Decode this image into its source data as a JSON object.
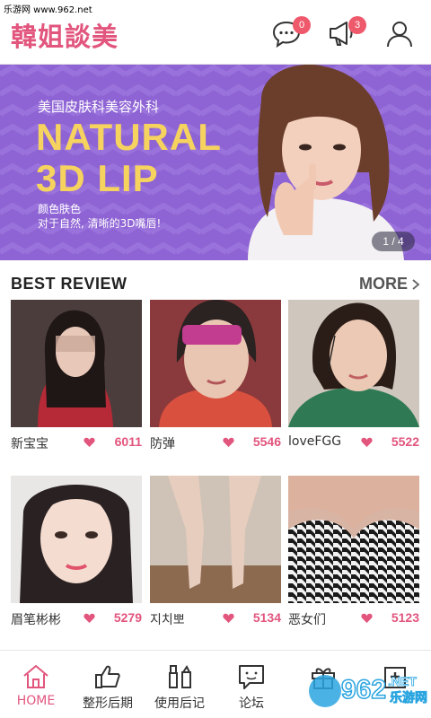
{
  "watermark_top": "乐游网 www.962.net",
  "header": {
    "logo": "韓姐談美",
    "chat_badge": "0",
    "notice_badge": "3",
    "icons": [
      "chat-icon",
      "megaphone-icon",
      "user-icon"
    ]
  },
  "banner": {
    "subtitle": "美国皮肤科美容外科",
    "title_line1": "NATURAL",
    "title_line2": "3D LIP",
    "desc_line1": "颜色肤色",
    "desc_line2": "对于自然, 清晰的3D嘴唇!",
    "pager": "1 / 4",
    "colors": {
      "bg": "#8e63d3",
      "title": "#f6d35e"
    }
  },
  "section": {
    "title": "BEST REVIEW",
    "more": "MORE"
  },
  "reviews": [
    {
      "name": "新宝宝",
      "likes": "6011"
    },
    {
      "name": "防弹",
      "likes": "5546"
    },
    {
      "name": "loveFGG",
      "likes": "5522"
    },
    {
      "name": "眉笔彬彬",
      "likes": "5279"
    },
    {
      "name": "지치뽀",
      "likes": "5134"
    },
    {
      "name": "恶女们",
      "likes": "5123"
    }
  ],
  "tabs": [
    {
      "label": "HOME",
      "icon": "home-icon",
      "active": true
    },
    {
      "label": "整形后期",
      "icon": "thumbs-up-icon",
      "active": false
    },
    {
      "label": "使用后记",
      "icon": "cosmetics-icon",
      "active": false
    },
    {
      "label": "论坛",
      "icon": "chat-bubble-icon",
      "active": false
    },
    {
      "label": "",
      "icon": "gift-icon",
      "active": false
    },
    {
      "label": "",
      "icon": "hospital-icon",
      "active": false
    }
  ],
  "watermark_logo": {
    "text1": "962",
    "text2": ".NET",
    "text3": "乐游网"
  },
  "accent_color": "#e2557d"
}
